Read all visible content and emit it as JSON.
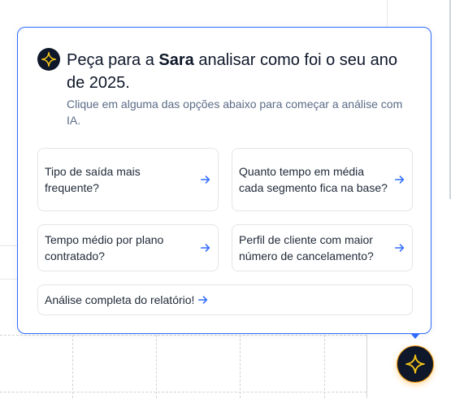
{
  "assistant": {
    "headline_prefix": "Peça para a ",
    "assistant_name": "Sara",
    "headline_suffix": " analisar como foi o seu ano de 2025.",
    "subtitle": "Clique em alguma das opções abaixo para começar a análise com IA.",
    "options": [
      {
        "label": "Tipo de saída mais frequente?"
      },
      {
        "label": "Quanto tempo em média cada segmento fica na base?"
      },
      {
        "label": "Tempo médio por plano contratado?"
      },
      {
        "label": "Perfil de cliente com maior número de cancelamento?"
      },
      {
        "label": "Análise completa do relatório!"
      }
    ]
  },
  "icons": {
    "badge": "sparkle-icon",
    "option_arrow": "arrow-right-icon",
    "fab": "sparkle-icon"
  },
  "colors": {
    "accent": "#2f6bff",
    "sparkle": "#f5c518",
    "dark": "#0f172a",
    "fab_glow": "#f59e0b"
  }
}
